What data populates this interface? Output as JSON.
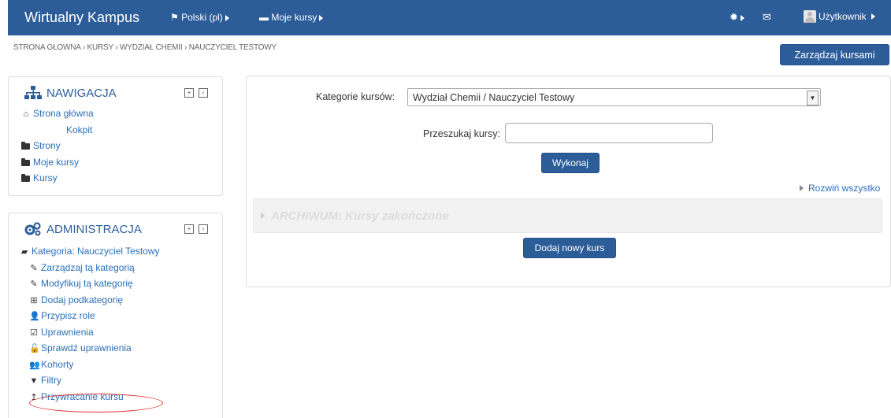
{
  "navbar": {
    "brand": "Wirtualny Kampus",
    "language": "Polski (pl)",
    "my_courses": "Moje kursy",
    "user": "Użytkownik"
  },
  "breadcrumb": "STRONA GŁOWNA › KURSY › WYDZIAŁ CHEMII › NAUCZYCIEL TESTOWY",
  "manage_button": "Zarządzaj kursami",
  "navigation": {
    "title": "NAWIGACJA",
    "items": [
      "Strona główna",
      "Kokpit",
      "Strony",
      "Moje kursy",
      "Kursy"
    ]
  },
  "administration": {
    "title": "ADMINISTRACJA",
    "category": "Kategoria: Nauczyciel Testowy",
    "items": [
      "Zarządzaj tą kategorią",
      "Modyfikuj tą kategorię",
      "Dodaj podkategorię",
      "Przypisz role",
      "Uprawnienia",
      "Sprawdź uprawnienia",
      "Kohorty",
      "Filtry",
      "Przywracanie kursu"
    ]
  },
  "main": {
    "categories_label": "Kategorie kursów:",
    "categories_value": "Wydział Chemii / Nauczyciel Testowy",
    "search_label": "Przeszukaj kursy:",
    "search_value": "",
    "go_button": "Wykonaj",
    "expand_all": "Rozwiń wszystko",
    "archive": "ARCHIWUM: Kursy zakończone",
    "add_course_button": "Dodaj nowy kurs"
  },
  "colors": {
    "navbar": "#2d5d99",
    "link": "#2a6fb8",
    "highlight": "#dd3333"
  }
}
